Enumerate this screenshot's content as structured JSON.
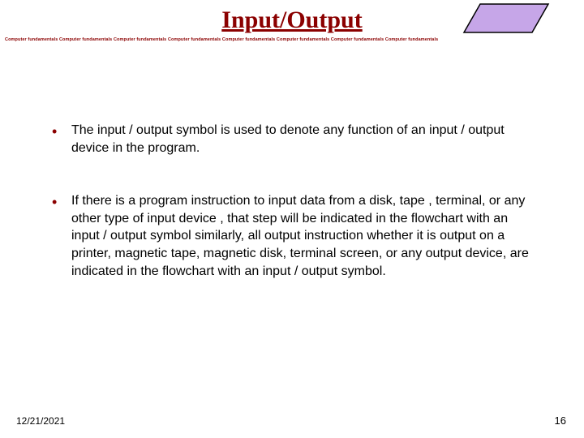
{
  "title": "Input/Output",
  "repeat_text": "Computer fundamentals Computer fundamentals Computer fundamentals Computer fundamentals Computer fundamentals Computer fundamentals Computer fundamentals Computer fundamentals",
  "bullets": [
    "The input / output symbol is used to denote any function of an input / output device in the program.",
    "If there is a program instruction to input data from a disk, tape , terminal, or any other type of input device , that step will be indicated in the flowchart with an input / output  symbol similarly, all output instruction whether it is output on a printer, magnetic tape, magnetic disk, terminal screen, or any output device, are indicated in the flowchart with an input / output symbol."
  ],
  "footer": {
    "date": "12/21/2021",
    "page": "16"
  },
  "shape": {
    "fill": "#C6A6E8",
    "stroke": "#000"
  }
}
